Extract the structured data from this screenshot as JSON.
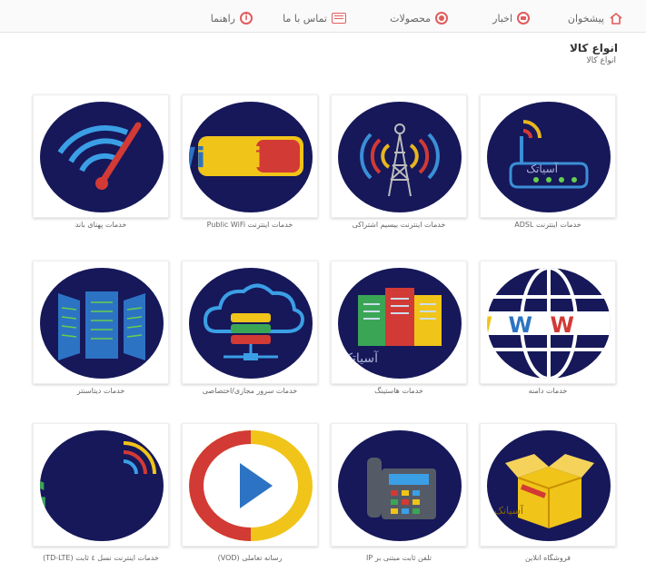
{
  "nav": {
    "dashboard": "پیشخوان",
    "news": "اخبار",
    "products": "محصولات",
    "contact": "تماس با ما",
    "help": "راهنما"
  },
  "section": {
    "title": "انواع کالا",
    "subtitle": "انواع کالا"
  },
  "products": [
    {
      "label": "خدمات اینترنت ADSL",
      "icon": "router-icon"
    },
    {
      "label": "خدمات اینترنت بیسیم اشتراکی",
      "icon": "antenna-tower-icon"
    },
    {
      "label": "خدمات اینترنت Public WiFi",
      "icon": "wifi-logo-icon"
    },
    {
      "label": "خدمات پهنای باند",
      "icon": "speedometer-icon"
    },
    {
      "label": "خدمات دامنه",
      "icon": "globe-www-icon"
    },
    {
      "label": "خدمات هاستینگ",
      "icon": "hosting-binders-icon"
    },
    {
      "label": "خدمات سرور مجازی/اختصاصی",
      "icon": "cloud-server-icon"
    },
    {
      "label": "خدمات دیتاسنتر",
      "icon": "datacenter-racks-icon"
    },
    {
      "label": "فروشگاه انلاین",
      "icon": "open-box-icon"
    },
    {
      "label": "تلفن ثابت مبتنی بر IP",
      "icon": "ip-phone-icon"
    },
    {
      "label": "رسانه تعاملی (VOD)",
      "icon": "play-button-icon"
    },
    {
      "label": "خدمات اینترنت نسل ٤ ثابت (TD-LTE)",
      "icon": "4g-icon"
    }
  ],
  "colors": {
    "circle": "#16185a",
    "accent": "#e15b5b"
  }
}
